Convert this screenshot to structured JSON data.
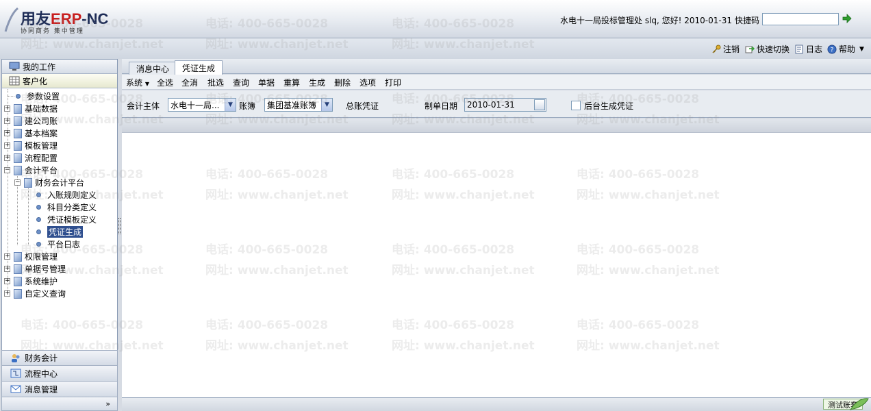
{
  "header": {
    "logo_brand_a": "用友",
    "logo_brand_b": "ERP",
    "logo_brand_c": "-NC",
    "logo_slogan": "协同商务  集中管理",
    "user_info": "水电十一局投标管理处 slq, 您好! 2010-01-31",
    "quick_label": "快捷码",
    "quick_value": ""
  },
  "toolbar": {
    "logout": "注销",
    "quick_switch": "快速切换",
    "log": "日志",
    "help": "帮助"
  },
  "sidebar": {
    "my_work": "我的工作",
    "customize": "客户化",
    "tree": [
      "参数设置",
      "基础数据",
      "建公司账",
      "基本档案",
      "模板管理",
      "流程配置",
      "会计平台",
      "财务会计平台",
      "入账规则定义",
      "科目分类定义",
      "凭证模板定义",
      "凭证生成",
      "平台日志",
      "权限管理",
      "单据号管理",
      "系统维护",
      "自定义查询"
    ],
    "bottom": [
      "财务会计",
      "流程中心",
      "消息管理"
    ],
    "more": "»"
  },
  "tabs": [
    "消息中心",
    "凭证生成"
  ],
  "menu": [
    "系统",
    "全选",
    "全消",
    "批选",
    "查询",
    "单据",
    "重算",
    "生成",
    "删除",
    "选项",
    "打印"
  ],
  "filter": {
    "entity_label": "会计主体",
    "entity_value": "水电十一局...",
    "book_label": "账簿",
    "book_value": "集团基准账簿",
    "summary_label": "总账凭证",
    "date_label": "制单日期",
    "date_value": "2010-01-31",
    "background_label": "后台生成凭证"
  },
  "status": {
    "text": "测试账套"
  },
  "watermark": {
    "phone": "电话: 400-665-0028",
    "site": "网址: www.chanjet.net"
  }
}
